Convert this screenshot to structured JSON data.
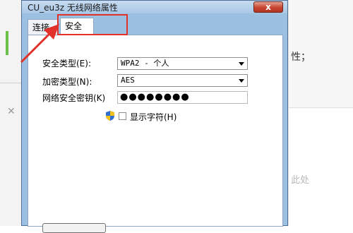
{
  "background": {
    "right_text": "性；",
    "right_hint": "此处",
    "left_mark": "✕"
  },
  "dialog": {
    "title": "CU_eu3z 无线网络属性",
    "close_glyph": "x",
    "tabs": [
      {
        "label": "连接",
        "selected": false
      },
      {
        "label": "安全",
        "selected": true
      }
    ],
    "fields": {
      "security_type_label": "安全类型(E):",
      "security_type_value": "WPA2 - 个人",
      "encryption_type_label": "加密类型(N):",
      "encryption_type_value": "AES",
      "network_key_label": "网络安全密钥(K)",
      "network_key_value": "●●●●●●●●",
      "show_chars_label": "显示字符(H)",
      "show_chars_checked": false
    }
  },
  "colors": {
    "annotation_red": "#e2312a",
    "dialog_frame": "#9cc0e2"
  }
}
